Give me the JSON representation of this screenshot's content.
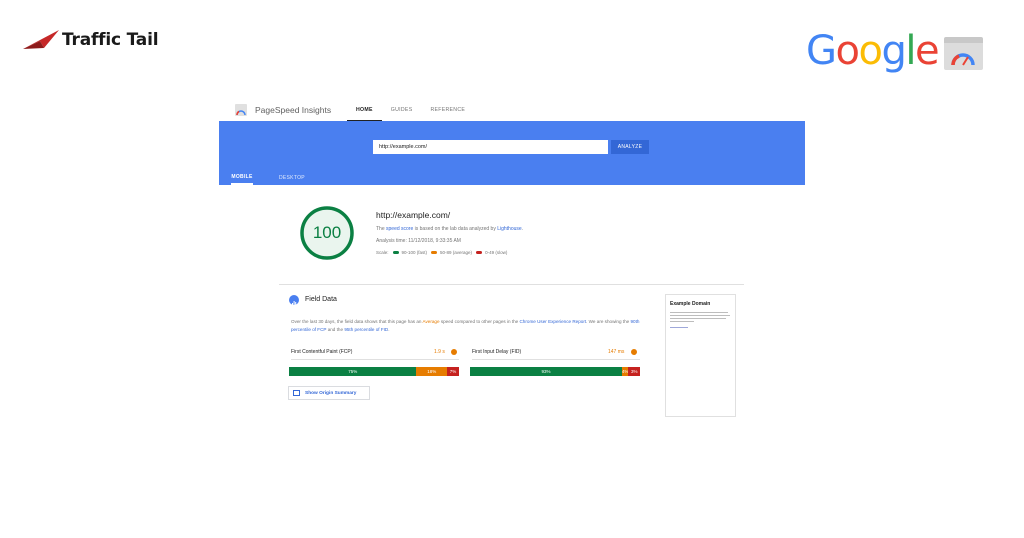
{
  "branding": {
    "traffic_tail": "Traffic Tail",
    "google_letters": [
      {
        "ch": "G",
        "color": "#4285F4"
      },
      {
        "ch": "o",
        "color": "#EA4335"
      },
      {
        "ch": "o",
        "color": "#FBBC05"
      },
      {
        "ch": "g",
        "color": "#4285F4"
      },
      {
        "ch": "l",
        "color": "#34A853"
      },
      {
        "ch": "e",
        "color": "#EA4335"
      }
    ]
  },
  "psi": {
    "brand": "PageSpeed Insights",
    "nav": [
      "HOME",
      "GUIDES",
      "REFERENCE"
    ],
    "url_value": "http://example.com/",
    "analyze_label": "ANALYZE",
    "device_tabs": [
      "MOBILE",
      "DESKTOP"
    ],
    "score": "100",
    "score_color": "#0b8043",
    "tested_url": "http://example.com/",
    "speed_prefix": "The ",
    "speed_link": "speed score",
    "speed_middle": " is based on the lab data analyzed by ",
    "speed_link2": "Lighthouse",
    "speed_suffix": ".",
    "analysis_time": "Analysis time: 11/12/2018, 9:33:35 AM",
    "scale_label": "Scale:",
    "scale": [
      {
        "label": "90-100 (fast)",
        "color": "#0b8043"
      },
      {
        "label": "50-89 (average)",
        "color": "#e67c00"
      },
      {
        "label": "0-49 (slow)",
        "color": "#c5221f"
      }
    ],
    "field_data": {
      "title": "Field Data",
      "desc_1": "Over the last 30 days, the field data shows that this page has an ",
      "desc_avg": "Average",
      "desc_2": " speed compared to other pages in the ",
      "desc_link1": "Chrome User Experience Report",
      "desc_3": ". We are showing the ",
      "desc_link2": "90th percentile of FCP",
      "desc_4": " and the ",
      "desc_link3": "95th percentile of FID",
      "desc_5": ".",
      "fcp": {
        "label": "First Contentful Paint (FCP)",
        "value": "1.9 s",
        "distribution": [
          {
            "label": "75%",
            "pct": 75,
            "kind": "g"
          },
          {
            "label": "18%",
            "pct": 18,
            "kind": "o"
          },
          {
            "label": "7%",
            "pct": 7,
            "kind": "r"
          }
        ]
      },
      "fid": {
        "label": "First Input Delay (FID)",
        "value": "147 ms",
        "distribution": [
          {
            "label": "93%",
            "pct": 93,
            "kind": "g"
          },
          {
            "label": "4%",
            "pct": 4,
            "kind": "o"
          },
          {
            "label": "3%",
            "pct": 3,
            "kind": "r"
          }
        ]
      },
      "origin_button": "Show Origin Summary"
    },
    "side_card": {
      "title": "Example Domain"
    }
  }
}
